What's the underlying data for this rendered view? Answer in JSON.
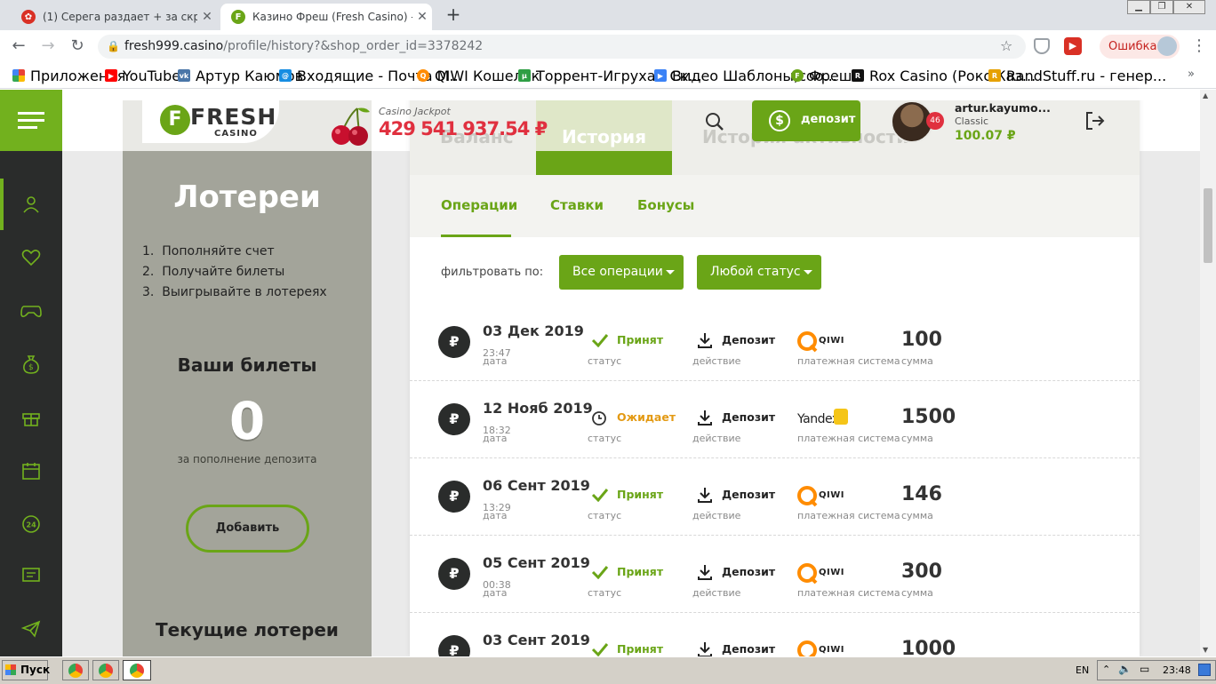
{
  "browser": {
    "tabs": [
      {
        "title": "(1) Серега раздает + за скрин при",
        "active": false
      },
      {
        "title": "Казино Фреш (Fresh Casino) - офи",
        "active": true
      }
    ],
    "url_host": "fresh999.casino",
    "url_path": "/profile/history?&shop_order_id=3378242",
    "error_label": "Ошибка",
    "bookmarks": [
      {
        "label": "Приложения",
        "color": "#e94235"
      },
      {
        "label": "YouTube",
        "color": "#ff0000"
      },
      {
        "label": "Артур Каюмов",
        "color": "#4a76a8"
      },
      {
        "label": "Входящие - Почта М...",
        "color": "#168de2"
      },
      {
        "label": "QIWI Кошелек",
        "color": "#ff8c00"
      },
      {
        "label": "Торрент-Игруха - Ск...",
        "color": "#2e9e44"
      },
      {
        "label": "Видео Шаблоны,соо...",
        "color": "#3b82f6"
      },
      {
        "label": "Фреш",
        "color": "#6aa517"
      },
      {
        "label": "Rox Casino (Рокс Каз...",
        "color": "#111111"
      },
      {
        "label": "RandStuff.ru - генер...",
        "color": "#e6a100"
      }
    ]
  },
  "header": {
    "logo_main": "FRESH",
    "logo_sub": "CASINO",
    "jackpot_label": "Casino Jackpot",
    "jackpot_value": "429 541 937.54 ₽",
    "deposit_label": "депозит",
    "user_name": "artur.kayumo...",
    "user_level": "Classic",
    "user_balance": "100.07 ₽",
    "user_badge": "46"
  },
  "profile_tabs": [
    "Баланс",
    "История",
    "История активности"
  ],
  "history_subtabs": [
    "Операции",
    "Ставки",
    "Бонусы"
  ],
  "filter": {
    "label": "фильтровать по:",
    "operations": "Все операции",
    "status": "Любой статус"
  },
  "column_labels": {
    "date": "дата",
    "status": "статус",
    "action": "действие",
    "payment": "платежная система",
    "amount": "сумма"
  },
  "transactions": [
    {
      "date": "03 Дек 2019",
      "time": "23:47",
      "status": "Принят",
      "status_type": "accepted",
      "action": "Депозит",
      "payment": "QIWI",
      "amount": "100"
    },
    {
      "date": "12 Нояб 2019",
      "time": "18:32",
      "status": "Ожидает",
      "status_type": "pending",
      "action": "Депозит",
      "payment": "Yandex",
      "amount": "1500"
    },
    {
      "date": "06 Сент 2019",
      "time": "13:29",
      "status": "Принят",
      "status_type": "accepted",
      "action": "Депозит",
      "payment": "QIWI",
      "amount": "146"
    },
    {
      "date": "05 Сент 2019",
      "time": "00:38",
      "status": "Принят",
      "status_type": "accepted",
      "action": "Депозит",
      "payment": "QIWI",
      "amount": "300"
    },
    {
      "date": "03 Сент 2019",
      "time": "",
      "status": "Принят",
      "status_type": "accepted",
      "action": "Депозит",
      "payment": "QIWI",
      "amount": "1000"
    }
  ],
  "lottery": {
    "title": "Лотереи",
    "steps": [
      "Пополняйте счет",
      "Получайте билеты",
      "Выигрывайте в лотереях"
    ],
    "tickets_title": "Ваши билеты",
    "tickets_count": "0",
    "tickets_note": "за пополнение депозита",
    "add_button": "Добавить",
    "current_title": "Текущие лотереи"
  },
  "taskbar": {
    "start": "Пуск",
    "lang": "EN",
    "clock": "23:48"
  },
  "colors": {
    "brand_green": "#6aa517",
    "sidebar_dark": "#2a2c2b",
    "jackpot_red": "#e0303f",
    "pending_orange": "#e39a14"
  }
}
